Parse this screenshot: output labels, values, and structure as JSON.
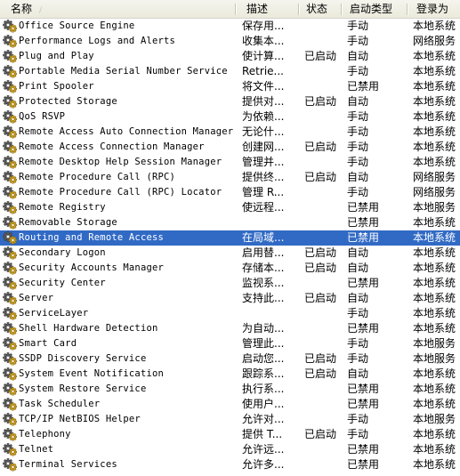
{
  "columns": {
    "name": "名称",
    "description": "描述",
    "status": "状态",
    "startup_type": "启动类型",
    "logon_as": "登录为",
    "sort_indicator": "/"
  },
  "selected_index": 14,
  "colors": {
    "selection": "#316ac5",
    "header_bg": "#ebeadb"
  },
  "services": [
    {
      "name": "Office Source Engine",
      "description": "保存用...",
      "status": "",
      "startup_type": "手动",
      "logon_as": "本地系统",
      "icon": "service-gear-icon"
    },
    {
      "name": "Performance Logs and Alerts",
      "description": "收集本...",
      "status": "",
      "startup_type": "手动",
      "logon_as": "网络服务",
      "icon": "service-gear-icon"
    },
    {
      "name": "Plug and Play",
      "description": "使计算...",
      "status": "已启动",
      "startup_type": "自动",
      "logon_as": "本地系统",
      "icon": "service-gear-icon"
    },
    {
      "name": "Portable Media Serial Number Service",
      "description": "Retrie...",
      "status": "",
      "startup_type": "手动",
      "logon_as": "本地系统",
      "icon": "service-gear-icon"
    },
    {
      "name": "Print Spooler",
      "description": "将文件...",
      "status": "",
      "startup_type": "已禁用",
      "logon_as": "本地系统",
      "icon": "service-gear-icon"
    },
    {
      "name": "Protected Storage",
      "description": "提供对...",
      "status": "已启动",
      "startup_type": "自动",
      "logon_as": "本地系统",
      "icon": "service-gear-icon"
    },
    {
      "name": "QoS RSVP",
      "description": "为依赖...",
      "status": "",
      "startup_type": "手动",
      "logon_as": "本地系统",
      "icon": "service-gear-icon"
    },
    {
      "name": "Remote Access Auto Connection Manager",
      "description": "无论什...",
      "status": "",
      "startup_type": "手动",
      "logon_as": "本地系统",
      "icon": "service-gear-icon"
    },
    {
      "name": "Remote Access Connection Manager",
      "description": "创建网...",
      "status": "已启动",
      "startup_type": "手动",
      "logon_as": "本地系统",
      "icon": "service-gear-icon"
    },
    {
      "name": "Remote Desktop Help Session Manager",
      "description": "管理并...",
      "status": "",
      "startup_type": "手动",
      "logon_as": "本地系统",
      "icon": "service-gear-icon"
    },
    {
      "name": "Remote Procedure Call (RPC)",
      "description": "提供终...",
      "status": "已启动",
      "startup_type": "自动",
      "logon_as": "网络服务",
      "icon": "service-gear-icon"
    },
    {
      "name": "Remote Procedure Call (RPC) Locator",
      "description": "管理 R...",
      "status": "",
      "startup_type": "手动",
      "logon_as": "网络服务",
      "icon": "service-gear-icon"
    },
    {
      "name": "Remote Registry",
      "description": "使远程...",
      "status": "",
      "startup_type": "已禁用",
      "logon_as": "本地服务",
      "icon": "service-gear-icon"
    },
    {
      "name": "Removable Storage",
      "description": "",
      "status": "",
      "startup_type": "已禁用",
      "logon_as": "本地系统",
      "icon": "service-gear-icon"
    },
    {
      "name": "Routing and Remote Access",
      "description": "在局域...",
      "status": "",
      "startup_type": "已禁用",
      "logon_as": "本地系统",
      "icon": "service-gear-icon"
    },
    {
      "name": "Secondary Logon",
      "description": "启用替...",
      "status": "已启动",
      "startup_type": "自动",
      "logon_as": "本地系统",
      "icon": "service-gear-icon"
    },
    {
      "name": "Security Accounts Manager",
      "description": "存储本...",
      "status": "已启动",
      "startup_type": "自动",
      "logon_as": "本地系统",
      "icon": "service-gear-icon"
    },
    {
      "name": "Security Center",
      "description": "监视系...",
      "status": "",
      "startup_type": "已禁用",
      "logon_as": "本地系统",
      "icon": "service-gear-icon"
    },
    {
      "name": "Server",
      "description": "支持此...",
      "status": "已启动",
      "startup_type": "自动",
      "logon_as": "本地系统",
      "icon": "service-gear-icon"
    },
    {
      "name": "ServiceLayer",
      "description": "",
      "status": "",
      "startup_type": "手动",
      "logon_as": "本地系统",
      "icon": "service-gear-icon"
    },
    {
      "name": "Shell Hardware Detection",
      "description": "为自动...",
      "status": "",
      "startup_type": "已禁用",
      "logon_as": "本地系统",
      "icon": "service-gear-icon"
    },
    {
      "name": "Smart Card",
      "description": "管理此...",
      "status": "",
      "startup_type": "手动",
      "logon_as": "本地服务",
      "icon": "service-gear-icon"
    },
    {
      "name": "SSDP Discovery Service",
      "description": "启动您...",
      "status": "已启动",
      "startup_type": "手动",
      "logon_as": "本地服务",
      "icon": "service-gear-icon"
    },
    {
      "name": "System Event Notification",
      "description": "跟踪系...",
      "status": "已启动",
      "startup_type": "自动",
      "logon_as": "本地系统",
      "icon": "service-gear-icon"
    },
    {
      "name": "System Restore Service",
      "description": "执行系...",
      "status": "",
      "startup_type": "已禁用",
      "logon_as": "本地系统",
      "icon": "service-gear-icon"
    },
    {
      "name": "Task Scheduler",
      "description": "使用户...",
      "status": "",
      "startup_type": "已禁用",
      "logon_as": "本地系统",
      "icon": "service-gear-icon"
    },
    {
      "name": "TCP/IP NetBIOS Helper",
      "description": "允许对...",
      "status": "",
      "startup_type": "手动",
      "logon_as": "本地服务",
      "icon": "service-gear-icon"
    },
    {
      "name": "Telephony",
      "description": "提供 T...",
      "status": "已启动",
      "startup_type": "手动",
      "logon_as": "本地系统",
      "icon": "service-gear-icon"
    },
    {
      "name": "Telnet",
      "description": "允许远...",
      "status": "",
      "startup_type": "已禁用",
      "logon_as": "本地系统",
      "icon": "service-gear-icon"
    },
    {
      "name": "Terminal Services",
      "description": "允许多...",
      "status": "",
      "startup_type": "已禁用",
      "logon_as": "本地系统",
      "icon": "service-gear-icon"
    }
  ]
}
